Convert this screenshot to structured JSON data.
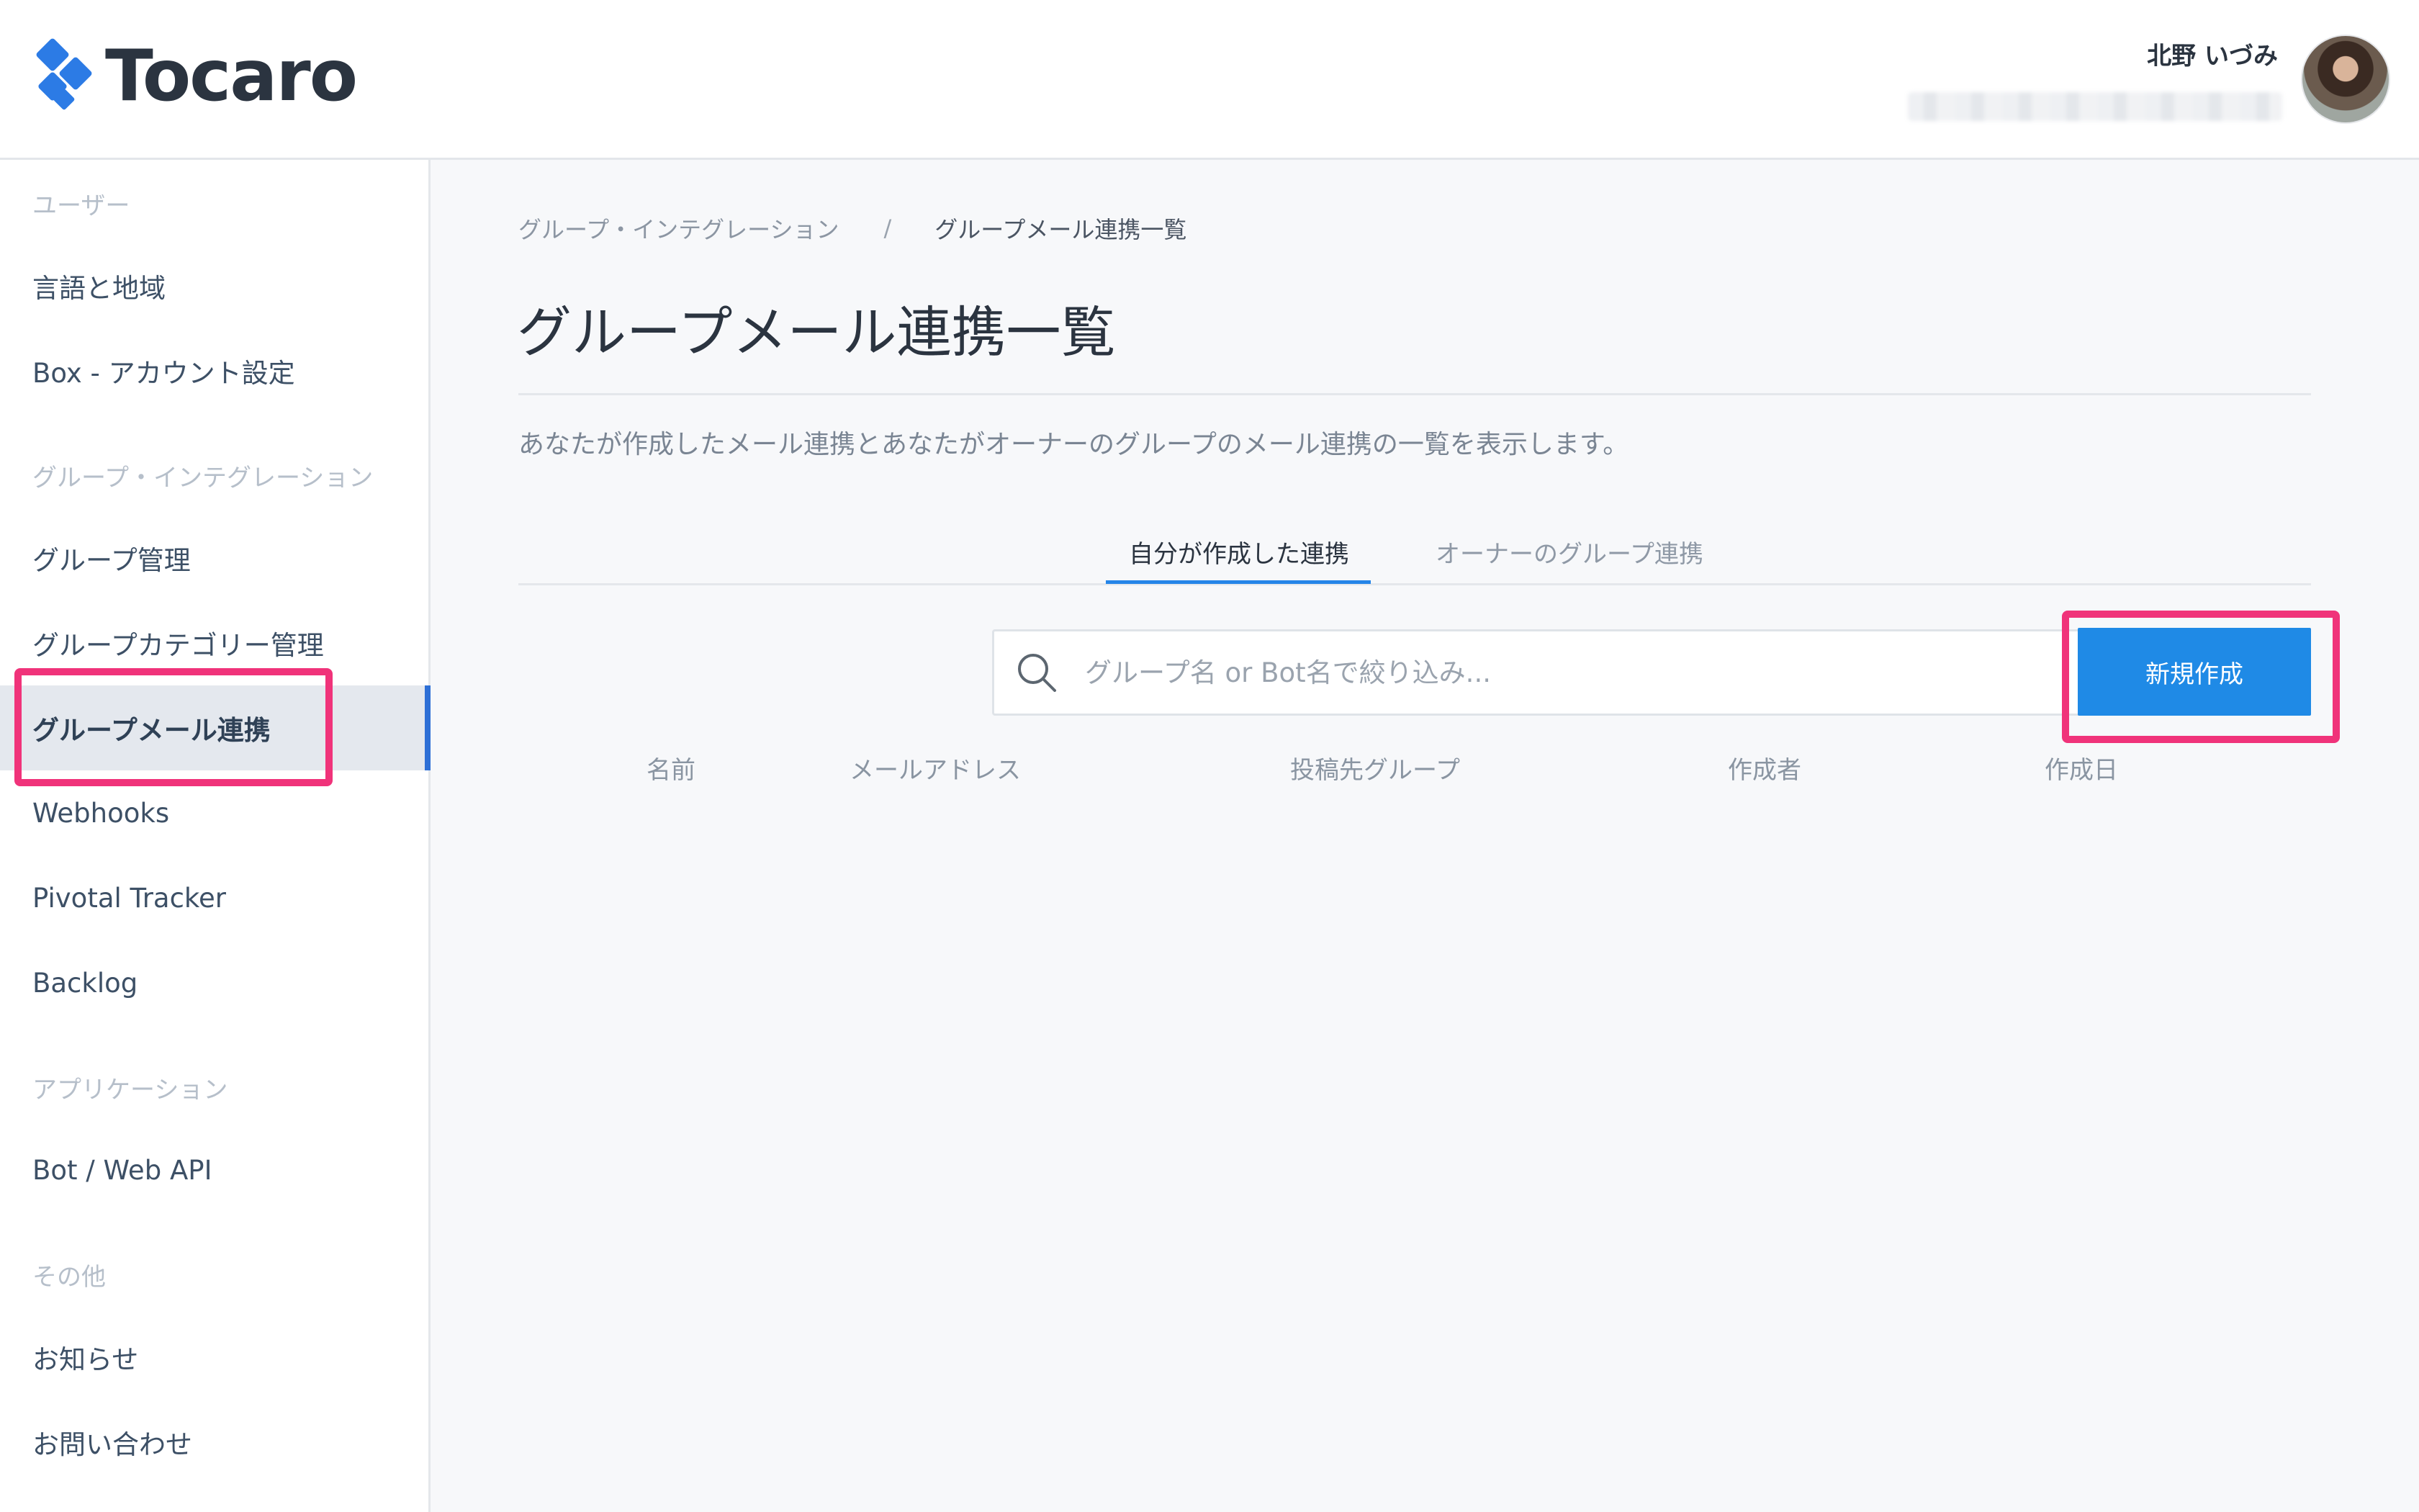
{
  "header": {
    "logo_text": "Tocaro",
    "user_name": "北野 いづみ"
  },
  "sidebar": {
    "sections": [
      {
        "label": "ユーザー",
        "items": [
          "言語と地域",
          "Box - アカウント設定"
        ]
      },
      {
        "label": "グループ・インテグレーション",
        "items": [
          "グループ管理",
          "グループカテゴリー管理",
          "グループメール連携",
          "Webhooks",
          "Pivotal Tracker",
          "Backlog"
        ]
      },
      {
        "label": "アプリケーション",
        "items": [
          "Bot / Web API"
        ]
      },
      {
        "label": "その他",
        "items": [
          "お知らせ",
          "お問い合わせ"
        ]
      }
    ],
    "active_item": "グループメール連携"
  },
  "breadcrumb": {
    "parent": "グループ・インテグレーション",
    "separator": "/",
    "current": "グループメール連携一覧"
  },
  "page": {
    "title": "グループメール連携一覧",
    "description": "あなたが作成したメール連携とあなたがオーナーのグループのメール連携の一覧を表示します。"
  },
  "tabs": [
    {
      "label": "自分が作成した連携",
      "active": true
    },
    {
      "label": "オーナーのグループ連携",
      "active": false
    }
  ],
  "search": {
    "placeholder": "グループ名 or Bot名で絞り込み...",
    "value": ""
  },
  "new_button_label": "新規作成",
  "table": {
    "columns": [
      "名前",
      "メールアドレス",
      "投稿先グループ",
      "作成者",
      "作成日"
    ],
    "rows": []
  },
  "colors": {
    "accent": "#1f8ae6",
    "highlight": "#f0337a",
    "active_bar": "#2d6fd6"
  }
}
